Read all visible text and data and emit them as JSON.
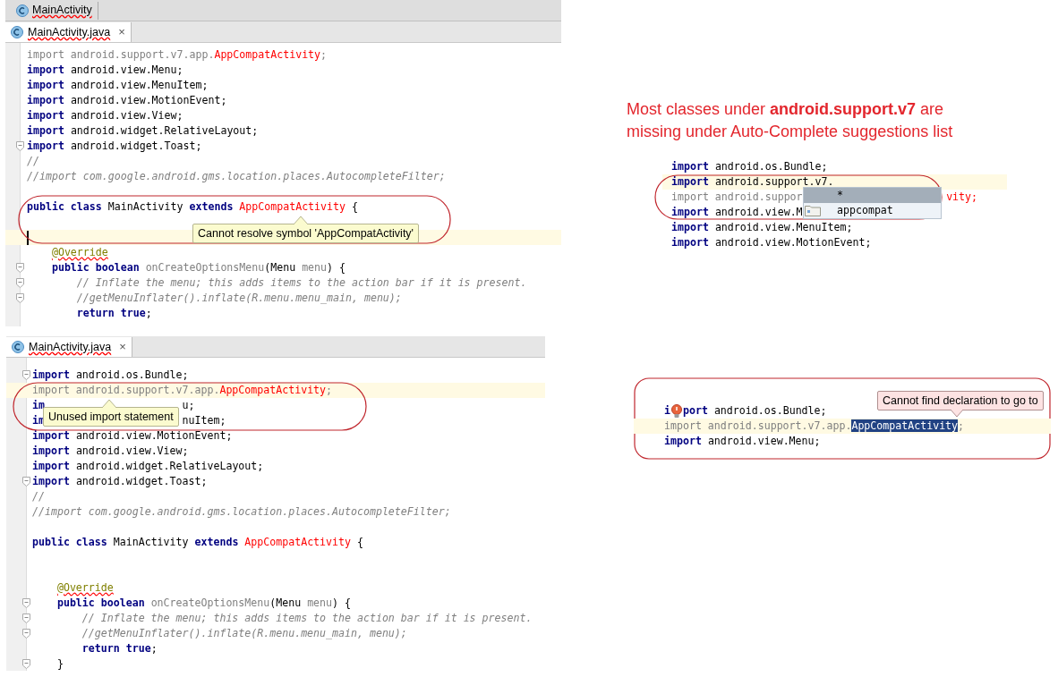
{
  "editors": [
    {
      "breadcrumb": "MainActivity",
      "tab": {
        "label": "MainActivity.java",
        "close": "×",
        "selected": true
      },
      "lines": [
        {
          "tokens": [
            {
              "kind": "unused",
              "text": "import android.support.v7.app."
            },
            {
              "kind": "error",
              "text": "AppCompatActivity"
            },
            {
              "kind": "unused",
              "text": ";"
            }
          ]
        },
        {
          "tokens": [
            {
              "kind": "keyword",
              "text": "import"
            },
            {
              "kind": "plain",
              "text": " android.view.Menu;"
            }
          ]
        },
        {
          "tokens": [
            {
              "kind": "keyword",
              "text": "import"
            },
            {
              "kind": "plain",
              "text": " android.view.MenuItem;"
            }
          ]
        },
        {
          "tokens": [
            {
              "kind": "keyword",
              "text": "import"
            },
            {
              "kind": "plain",
              "text": " android.view.MotionEvent;"
            }
          ]
        },
        {
          "tokens": [
            {
              "kind": "keyword",
              "text": "import"
            },
            {
              "kind": "plain",
              "text": " android.view.View;"
            }
          ]
        },
        {
          "tokens": [
            {
              "kind": "keyword",
              "text": "import"
            },
            {
              "kind": "plain",
              "text": " android.widget.RelativeLayout;"
            }
          ]
        },
        {
          "fold": true,
          "tokens": [
            {
              "kind": "keyword",
              "text": "import"
            },
            {
              "kind": "plain",
              "text": " android.widget.Toast;"
            }
          ]
        },
        {
          "tokens": [
            {
              "kind": "comment",
              "text": "//"
            }
          ]
        },
        {
          "tokens": [
            {
              "kind": "comment",
              "text": "//import com.google.android.gms.location.places.AutocompleteFilter;"
            }
          ]
        },
        {
          "kind": "blank"
        },
        {
          "tokens": [
            {
              "kind": "keyword",
              "text": "public class"
            },
            {
              "kind": "plain",
              "text": " MainActivity "
            },
            {
              "kind": "keyword",
              "text": "extends "
            },
            {
              "kind": "error",
              "text": "AppCompatActivity"
            },
            {
              "kind": "plain",
              "text": " {"
            }
          ]
        },
        {
          "kind": "blank"
        },
        {
          "kind": "blank",
          "current": true,
          "caret": true
        },
        {
          "tokens": [
            {
              "kind": "annotation",
              "text": "    @Override"
            }
          ]
        },
        {
          "fold": true,
          "tokens": [
            {
              "kind": "keyword",
              "text": "    public boolean "
            },
            {
              "kind": "unused",
              "text": "onCreateOptionsMenu"
            },
            {
              "kind": "plain",
              "text": "(Menu "
            },
            {
              "kind": "unused",
              "text": "menu"
            },
            {
              "kind": "plain",
              "text": ") {"
            }
          ]
        },
        {
          "fold": true,
          "tokens": [
            {
              "kind": "comment",
              "text": "        // Inflate the menu; this adds items to the action bar if it is present."
            }
          ]
        },
        {
          "fold": true,
          "tokens": [
            {
              "kind": "comment",
              "text": "        //getMenuInflater().inflate(R.menu.menu_main, menu);"
            }
          ]
        },
        {
          "tokens": [
            {
              "kind": "keyword",
              "text": "        return true"
            },
            {
              "kind": "plain",
              "text": ";"
            }
          ]
        }
      ],
      "tooltip": "Cannot resolve symbol 'AppCompatActivity'"
    },
    {
      "tab": {
        "label": "MainActivity.java",
        "close": "×",
        "selected": true
      },
      "lines": [
        {
          "fold": true,
          "tokens": [
            {
              "kind": "keyword",
              "text": "import"
            },
            {
              "kind": "plain",
              "text": " android.os.Bundle;"
            }
          ]
        },
        {
          "current": true,
          "tokens": [
            {
              "kind": "unused",
              "text": "import android.support.v7.app."
            },
            {
              "kind": "error",
              "text": "AppCompatActivity"
            },
            {
              "kind": "unused",
              "text": ";"
            }
          ]
        },
        {
          "kind": "covered",
          "tokens": [
            {
              "kind": "keyword",
              "text": "im"
            }
          ],
          "tail": [
            {
              "kind": "plain",
              "text": "u;"
            }
          ]
        },
        {
          "kind": "covered",
          "tokens": [
            {
              "kind": "keyword",
              "text": "im"
            }
          ],
          "tail": [
            {
              "kind": "plain",
              "text": "nuItem;"
            }
          ]
        },
        {
          "tokens": [
            {
              "kind": "keyword",
              "text": "import"
            },
            {
              "kind": "plain",
              "text": " android.view.MotionEvent;"
            }
          ]
        },
        {
          "tokens": [
            {
              "kind": "keyword",
              "text": "import"
            },
            {
              "kind": "plain",
              "text": " android.view.View;"
            }
          ]
        },
        {
          "tokens": [
            {
              "kind": "keyword",
              "text": "import"
            },
            {
              "kind": "plain",
              "text": " android.widget.RelativeLayout;"
            }
          ]
        },
        {
          "fold": true,
          "tokens": [
            {
              "kind": "keyword",
              "text": "import"
            },
            {
              "kind": "plain",
              "text": " android.widget.Toast;"
            }
          ]
        },
        {
          "tokens": [
            {
              "kind": "comment",
              "text": "//"
            }
          ]
        },
        {
          "tokens": [
            {
              "kind": "comment",
              "text": "//import com.google.android.gms.location.places.AutocompleteFilter;"
            }
          ]
        },
        {
          "kind": "blank"
        },
        {
          "tokens": [
            {
              "kind": "keyword",
              "text": "public class"
            },
            {
              "kind": "plain",
              "text": " MainActivity "
            },
            {
              "kind": "keyword",
              "text": "extends "
            },
            {
              "kind": "error",
              "text": "AppCompatActivity"
            },
            {
              "kind": "plain",
              "text": " {"
            }
          ]
        },
        {
          "kind": "blank"
        },
        {
          "kind": "blank"
        },
        {
          "tokens": [
            {
              "kind": "annotation",
              "text": "    @Override"
            }
          ]
        },
        {
          "fold": true,
          "tokens": [
            {
              "kind": "keyword",
              "text": "    public boolean "
            },
            {
              "kind": "unused",
              "text": "onCreateOptionsMenu"
            },
            {
              "kind": "plain",
              "text": "(Menu "
            },
            {
              "kind": "unused",
              "text": "menu"
            },
            {
              "kind": "plain",
              "text": ") {"
            }
          ]
        },
        {
          "fold": true,
          "tokens": [
            {
              "kind": "comment",
              "text": "        // Inflate the menu; this adds items to the action bar if it is present."
            }
          ]
        },
        {
          "fold": true,
          "tokens": [
            {
              "kind": "comment",
              "text": "        //getMenuInflater().inflate(R.menu.menu_main, menu);"
            }
          ]
        },
        {
          "tokens": [
            {
              "kind": "keyword",
              "text": "        return true"
            },
            {
              "kind": "plain",
              "text": ";"
            }
          ]
        },
        {
          "fold": true,
          "tokens": [
            {
              "kind": "plain",
              "text": "    }"
            }
          ]
        }
      ],
      "tooltip": "Unused import statement"
    }
  ],
  "note": "Most classes under **android.support.v7** are missing under Auto-Complete suggestions list",
  "autocomplete_snippet": {
    "lines": [
      {
        "tokens": [
          {
            "kind": "keyword",
            "text": "import"
          },
          {
            "kind": "plain",
            "text": " android.os.Bundle;"
          }
        ]
      },
      {
        "current": true,
        "tokens": [
          {
            "kind": "keyword",
            "text": "import"
          },
          {
            "kind": "plain",
            "text": " android.support.v7."
          }
        ]
      },
      {
        "kind": "covered",
        "tokens": [
          {
            "kind": "unused",
            "text": "import android.suppor"
          }
        ],
        "tail": [
          {
            "kind": "error",
            "text": "vity;"
          }
        ]
      },
      {
        "kind": "covered",
        "tokens": [
          {
            "kind": "keyword",
            "text": "import"
          },
          {
            "kind": "plain",
            "text": " android.view.M"
          }
        ]
      },
      {
        "tokens": [
          {
            "kind": "keyword",
            "text": "import"
          },
          {
            "kind": "plain",
            "text": " android.view.MenuItem;"
          }
        ]
      },
      {
        "tokens": [
          {
            "kind": "keyword",
            "text": "import"
          },
          {
            "kind": "plain",
            "text": " android.view.MotionEvent;"
          }
        ]
      }
    ],
    "suggestions": [
      {
        "label": "*",
        "selected": true
      },
      {
        "label": "appcompat",
        "selected": false,
        "kind": "package"
      }
    ]
  },
  "declaration_snippet": {
    "tooltip": "Cannot find declaration to go to",
    "lines": [
      {
        "kind": "covered",
        "bulb": true,
        "tokens": [
          {
            "kind": "keyword",
            "text": "i"
          }
        ],
        "tail": [
          {
            "kind": "keyword",
            "text": "port"
          },
          {
            "kind": "plain",
            "text": " android.os.Bundle;"
          }
        ]
      },
      {
        "current": true,
        "tokens": [
          {
            "kind": "unused",
            "text": "import android.support.v7.app."
          },
          {
            "kind": "selected",
            "text": "AppCompatActivity"
          },
          {
            "kind": "unused",
            "text": ";"
          }
        ]
      },
      {
        "tokens": [
          {
            "kind": "keyword",
            "text": "import"
          },
          {
            "kind": "plain",
            "text": " android.view.Menu;"
          }
        ]
      }
    ]
  }
}
